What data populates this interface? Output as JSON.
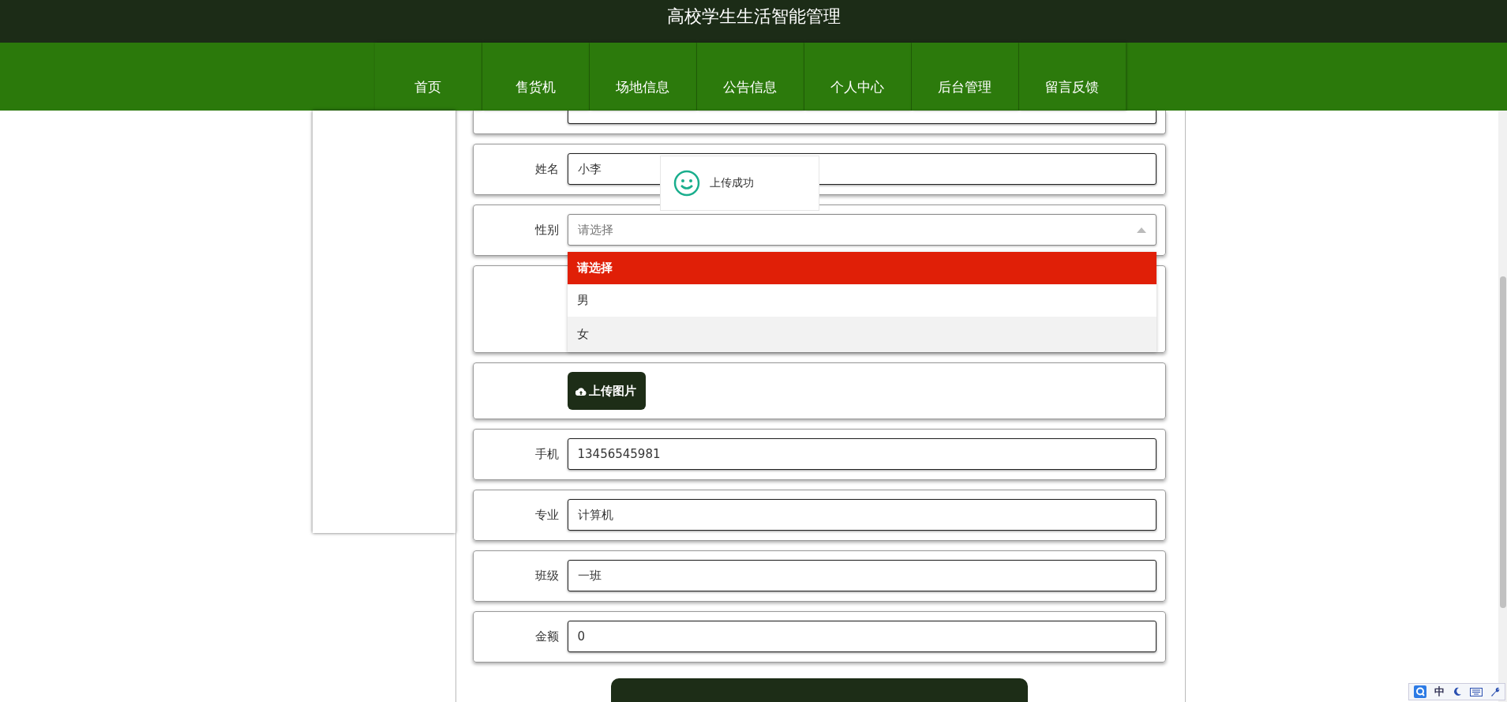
{
  "header": {
    "title": "高校学生生活智能管理"
  },
  "nav": [
    {
      "label": "首页"
    },
    {
      "label": "售货机"
    },
    {
      "label": "场地信息"
    },
    {
      "label": "公告信息"
    },
    {
      "label": "个人中心"
    },
    {
      "label": "后台管理"
    },
    {
      "label": "留言反馈"
    }
  ],
  "form": {
    "rows": [
      {
        "kind": "cut"
      },
      {
        "kind": "text",
        "label": "姓名",
        "value": "小李",
        "toast": {
          "message": "上传成功"
        }
      },
      {
        "kind": "select",
        "label": "性别",
        "placeholder": "请选择",
        "expanded": true,
        "options": [
          {
            "label": "请选择",
            "selected": true,
            "hovered": false
          },
          {
            "label": "男",
            "selected": false,
            "hovered": false
          },
          {
            "label": "女",
            "selected": false,
            "hovered": true
          }
        ]
      },
      {
        "kind": "image"
      },
      {
        "kind": "upload",
        "button": "上传图片"
      },
      {
        "kind": "text",
        "label": "手机",
        "value": "13456545981"
      },
      {
        "kind": "text",
        "label": "专业",
        "value": "计算机"
      },
      {
        "kind": "text",
        "label": "班级",
        "value": "一班"
      },
      {
        "kind": "text",
        "label": "金额",
        "value": "0"
      }
    ]
  },
  "ime_bar": {
    "label": "中"
  }
}
